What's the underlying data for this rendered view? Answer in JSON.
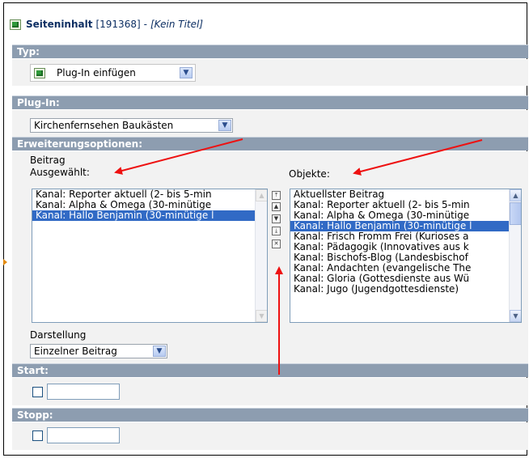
{
  "header": {
    "title": "Seiteninhalt",
    "id": "[191368]",
    "separator": "-",
    "note": "[Kein Titel]"
  },
  "sections": {
    "typ": "Typ:",
    "plugin": "Plug-In:",
    "erweiterung": "Erweiterungsoptionen:",
    "start": "Start:",
    "stopp": "Stopp:"
  },
  "typ_select": {
    "value": "Plug-In einfügen"
  },
  "plugin_select": {
    "value": "Kirchenfernsehen Baukästen"
  },
  "beitrag": {
    "label": "Beitrag",
    "selected_label": "Ausgewählt:",
    "objects_label": "Objekte:",
    "selected_items": [
      "Kanal: Reporter aktuell (2- bis 5-min",
      "Kanal: Alpha & Omega (30-minütige",
      "Kanal: Hallo Benjamin (30-minütige l"
    ],
    "selected_index": 2,
    "object_items": [
      "Aktuellster Beitrag",
      "Kanal: Reporter aktuell (2- bis 5-min",
      "Kanal: Alpha & Omega (30-minütige",
      "Kanal: Hallo Benjamin (30-minütige l",
      "Kanal: Frisch Fromm Frei (Kurioses a",
      "Kanal: Pädagogik (Innovatives aus k",
      "Kanal: Bischofs-Blog (Landesbischof",
      "Kanal: Andachten (evangelische The",
      "Kanal: Gloria (Gottesdienste aus Wü",
      "Kanal: Jugo (Jugendgottesdienste)"
    ],
    "object_selected_index": 3
  },
  "darstellung": {
    "label": "Darstellung",
    "value": "Einzelner Beitrag"
  },
  "colors": {
    "section_bar": "#8d9db0",
    "selection": "#316ac5",
    "annotation_arrow": "#ee1111",
    "title_text": "#0d2f63"
  }
}
